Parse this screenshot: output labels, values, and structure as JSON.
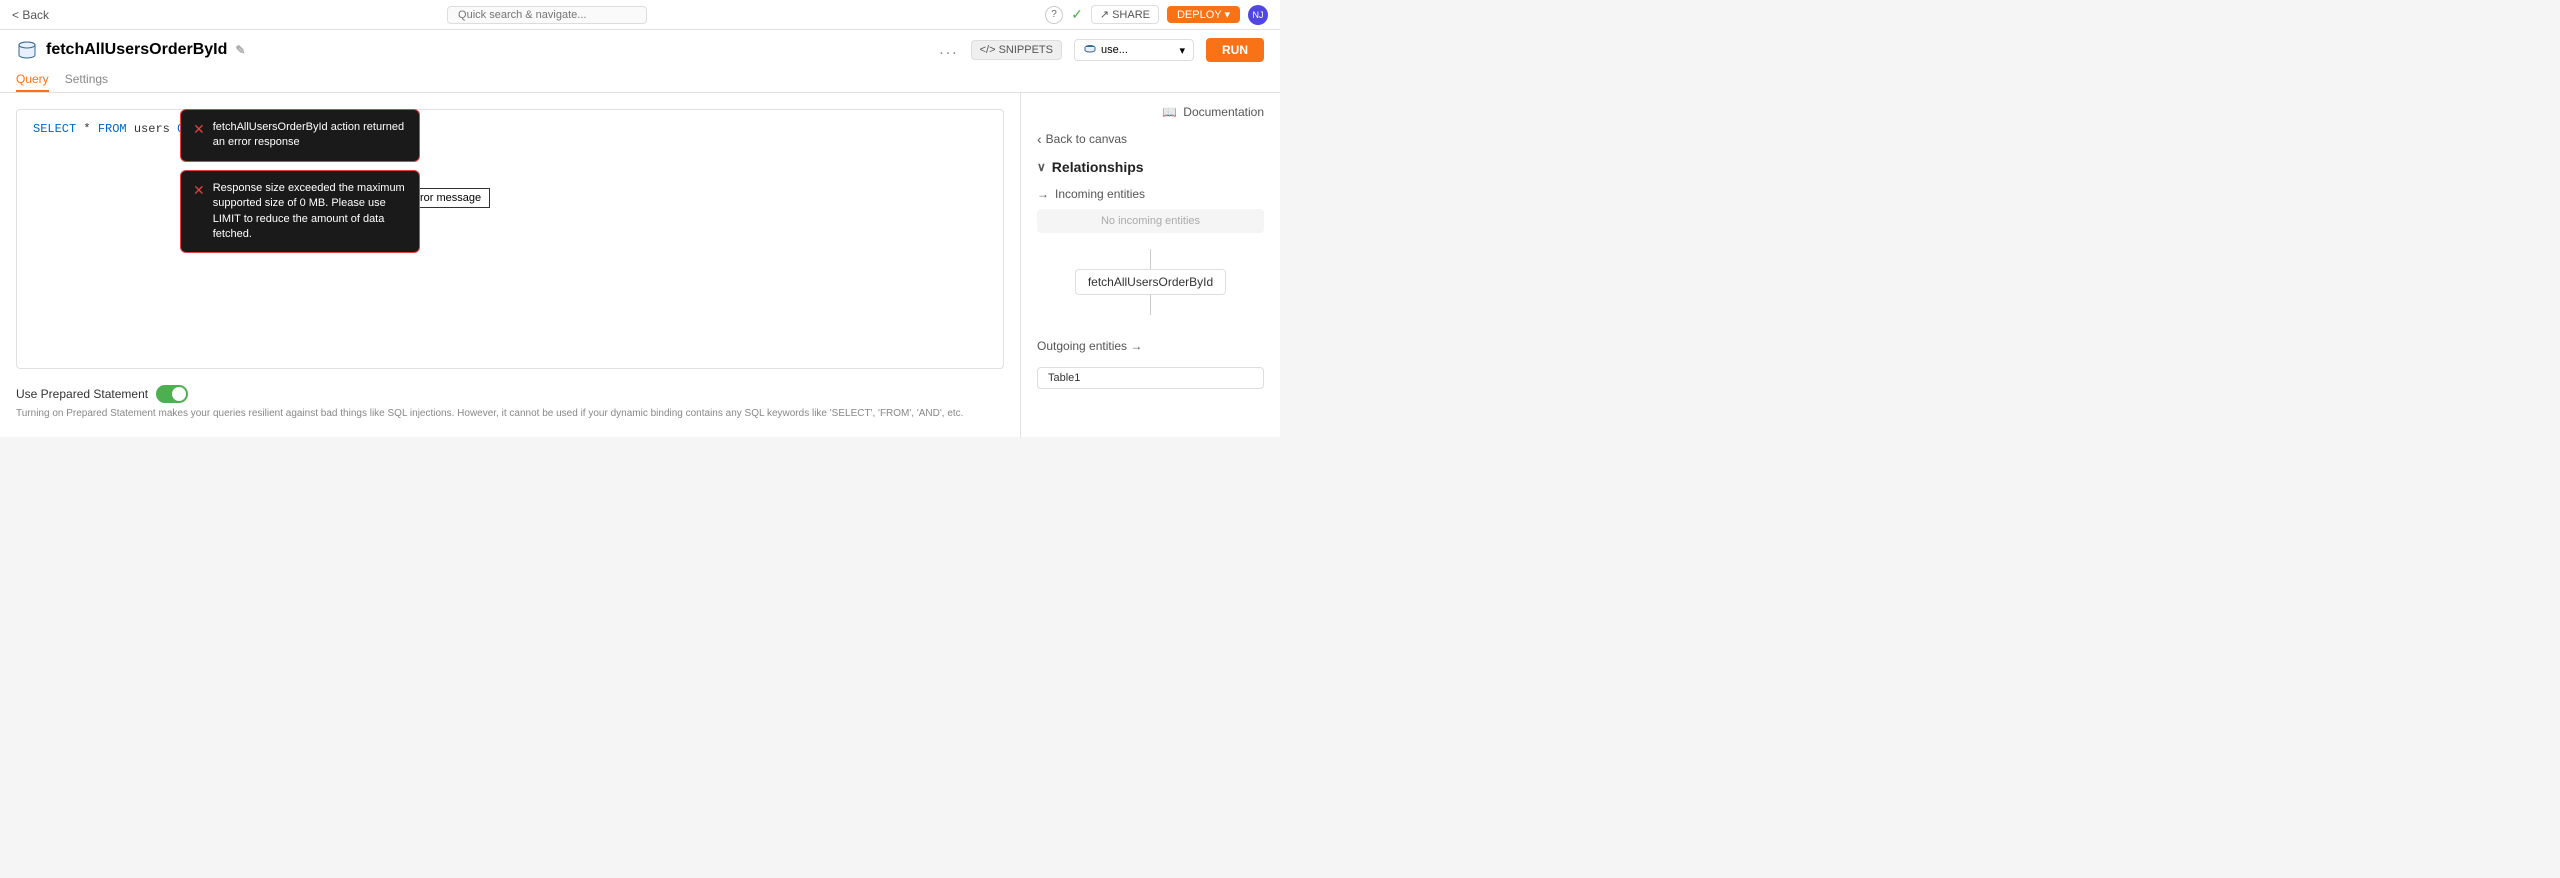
{
  "topbar": {
    "back_label": "< Back",
    "quick_search_placeholder": "Quick search & navigate...",
    "help_icon": "?",
    "check_icon": "✓",
    "share_label": "↗ SHARE",
    "deploy_label": "DEPLOY ▾",
    "avatar_initials": "NJ"
  },
  "header": {
    "action_name": "fetchAllUsersOrderById",
    "more_label": "...",
    "snippets_label": "</> SNIPPETS",
    "datasource_label": "use...",
    "run_label": "RUN"
  },
  "tabs": [
    {
      "label": "Query",
      "active": true
    },
    {
      "label": "Settings",
      "active": false
    }
  ],
  "editor": {
    "code": "SELECT * FROM users ORDER BY id;"
  },
  "errors": [
    {
      "id": "error1",
      "text": "fetchAllUsersOrderById action returned an error response"
    },
    {
      "id": "error2",
      "text": "Response size exceeded the maximum supported size of 0 MB. Please use LIMIT to reduce the amount of data fetched."
    }
  ],
  "error_label": "Error message",
  "prepared_statement": {
    "label": "Use Prepared Statement",
    "description": "Turning on Prepared Statement makes your queries resilient against bad things like SQL injections. However, it cannot be used if your dynamic binding contains any SQL keywords like 'SELECT', 'FROM', 'AND', etc.",
    "enabled": true
  },
  "right_panel": {
    "documentation_label": "Documentation",
    "back_to_canvas": "Back to canvas",
    "relationships_label": "Relationships",
    "incoming_label": "Incoming entities",
    "no_incoming_label": "No incoming entities",
    "entity_name": "fetchAllUsersOrderById",
    "outgoing_label": "Outgoing entities →",
    "outgoing_entity": "Table1"
  }
}
